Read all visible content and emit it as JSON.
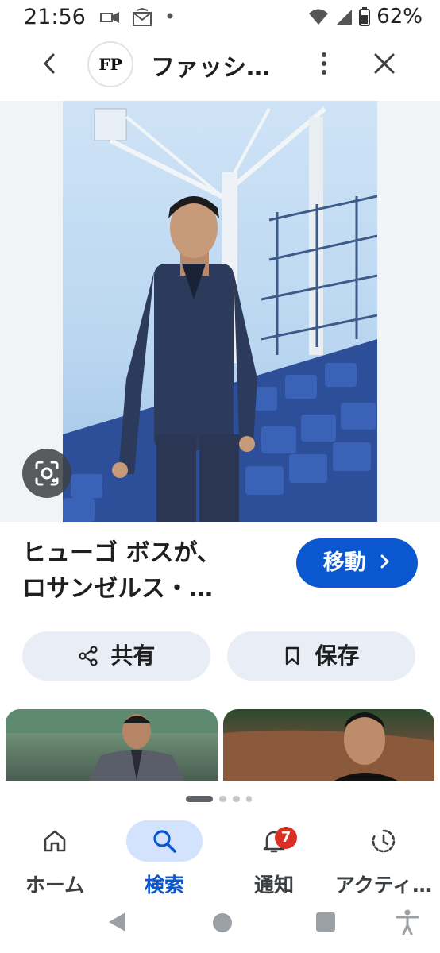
{
  "status_bar": {
    "time": "21:56",
    "battery": "62%",
    "icons": [
      "cast-icon",
      "mail-icon",
      "dot-icon",
      "wifi-icon",
      "signal-icon",
      "battery-icon"
    ]
  },
  "top_bar": {
    "site_favicon_text": "FP",
    "site_title": "ファッシ…",
    "back_icon": "arrow-left-icon",
    "more_icon": "more-vert-icon",
    "close_icon": "close-icon"
  },
  "result": {
    "caption_line1": "ヒューゴ ボスが、",
    "caption_line2": "ロサンゼルス・…",
    "visit_label": "移動",
    "share_label": "共有",
    "save_label": "保存"
  },
  "carousel": {
    "active_index": 0,
    "count": 4
  },
  "bottom_nav": {
    "items": [
      {
        "label": "ホーム",
        "icon": "home-icon",
        "active": false
      },
      {
        "label": "検索",
        "icon": "search-icon",
        "active": true
      },
      {
        "label": "通知",
        "icon": "bell-icon",
        "active": false
      },
      {
        "label": "アクティ…",
        "icon": "activity-icon",
        "active": false
      }
    ],
    "notification_count": "7"
  },
  "colors": {
    "accent": "#0b57d0",
    "accent_light": "#d3e3fd",
    "pill_bg": "#e9eef6",
    "badge": "#d93025"
  }
}
